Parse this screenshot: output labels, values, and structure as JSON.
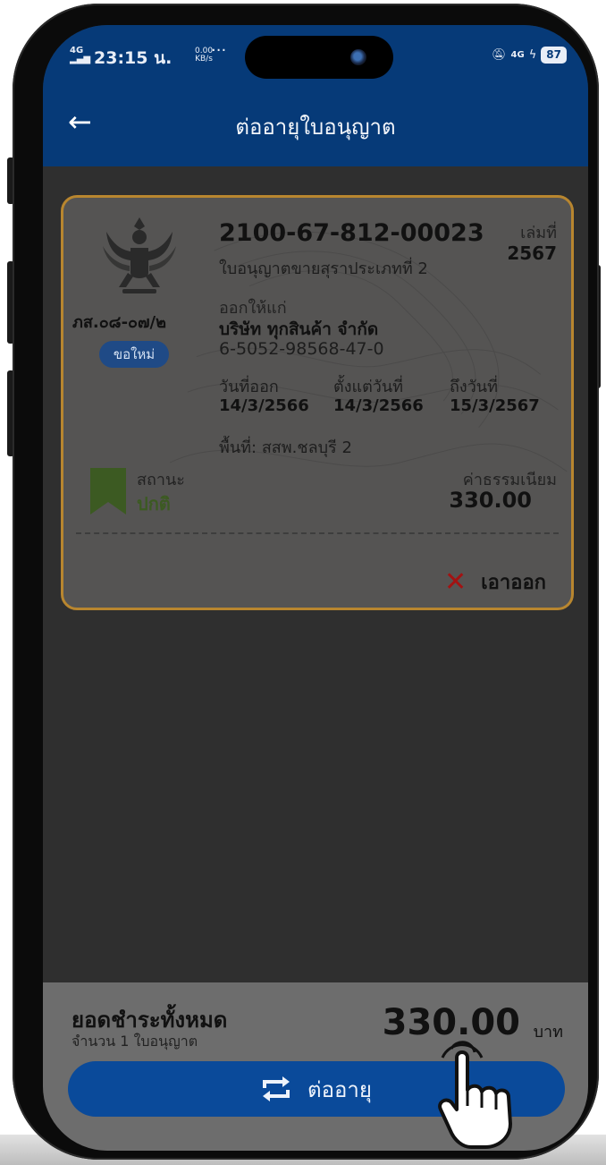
{
  "status_bar": {
    "network": "4G",
    "time": "23:15 น.",
    "speed_value": "0.00",
    "speed_unit": "KB/s",
    "more": "···",
    "sim2": "4G",
    "battery": "87"
  },
  "header": {
    "title": "ต่ออายุใบอนุญาต",
    "back_icon": "arrow-left-icon"
  },
  "license_card": {
    "license_number": "2100-67-812-00023",
    "license_type": "ใบอนุญาตขายสุราประเภทที่ 2",
    "book_label": "เล่มที่",
    "book_number": "2567",
    "form_code": "ภส.๐๘-๐๗/๒",
    "badge": "ขอใหม่",
    "issued_to_label": "ออกให้แก่",
    "company_name": "บริษัท ทุกสินค้า จำกัด",
    "tax_id": "6-5052-98568-47-0",
    "issue_date_label": "วันที่ออก",
    "issue_date": "14/3/2566",
    "from_date_label": "ตั้งแต่วันที่",
    "from_date": "14/3/2566",
    "to_date_label": "ถึงวันที่",
    "to_date": "15/3/2567",
    "area": "พื้นที่: สสพ.ชลบุรี 2",
    "status_label": "สถานะ",
    "status_value": "ปกติ",
    "fee_label": "ค่าธรรมเนียม",
    "fee_value": "330.00",
    "remove_label": "เอาออก",
    "colors": {
      "border": "#b8862f",
      "status": "#3c5a22",
      "remove_x": "#a31212"
    }
  },
  "footer": {
    "total_label": "ยอดชำระทั้งหมด",
    "total_sub": "จำนวน 1 ใบอนุญาต",
    "total_amount": "330.00",
    "total_unit": "บาท",
    "renew_button": "ต่ออายุ",
    "accent": "#0a4a9a"
  }
}
